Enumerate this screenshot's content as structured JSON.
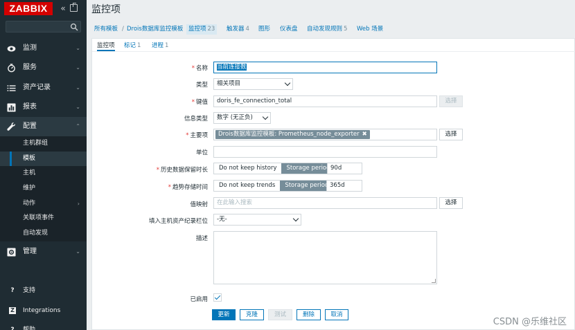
{
  "sidebar": {
    "logo": "ZABBIX",
    "search_placeholder": "",
    "menu": [
      {
        "label": "监测",
        "icon": "eye-icon"
      },
      {
        "label": "服务",
        "icon": "clock-icon"
      },
      {
        "label": "资产记录",
        "icon": "list-icon"
      },
      {
        "label": "报表",
        "icon": "chart-icon"
      },
      {
        "label": "配置",
        "icon": "wrench-icon"
      },
      {
        "label": "管理",
        "icon": "cog-icon"
      }
    ],
    "config_sub": [
      "主机群组",
      "模板",
      "主机",
      "维护",
      "动作",
      "关联项事件",
      "自动发现"
    ],
    "bottom": [
      {
        "label": "支持",
        "icon": "support-icon"
      },
      {
        "label": "Integrations",
        "icon": "integrations-icon"
      },
      {
        "label": "帮助",
        "icon": "help-icon"
      }
    ]
  },
  "main": {
    "title": "监控项",
    "breadcrumb": {
      "all_templates": "所有模板",
      "sep": "/",
      "template": "Drois数据库监控模板"
    },
    "tabs": [
      {
        "label": "监控项",
        "count": "23"
      },
      {
        "label": "触发器",
        "count": "4"
      },
      {
        "label": "图形",
        "count": ""
      },
      {
        "label": "仪表盘",
        "count": ""
      },
      {
        "label": "自动发现规则",
        "count": "5"
      },
      {
        "label": "Web 场景",
        "count": ""
      }
    ],
    "subtabs": [
      {
        "label": "监控项",
        "count": ""
      },
      {
        "label": "标记",
        "count": "1"
      },
      {
        "label": "进程",
        "count": "1"
      }
    ]
  },
  "form": {
    "name_label": "名称",
    "name_value": "当前连接数",
    "type_label": "类型",
    "type_value": "相关项目",
    "key_label": "键值",
    "key_value": "doris_fe_connection_total",
    "key_select": "选择",
    "info_type_label": "信息类型",
    "info_type_value": "数字 (无正负)",
    "master_label": "主要项",
    "master_value": "Drois数据库监控模板: Prometheus_node_exporter",
    "master_select": "选择",
    "units_label": "单位",
    "units_value": "",
    "history_label": "历史数据保留时长",
    "history_opt1": "Do not keep history",
    "history_opt2": "Storage period",
    "history_value": "90d",
    "trends_label": "趋势存储时间",
    "trends_opt1": "Do not keep trends",
    "trends_opt2": "Storage period",
    "trends_value": "365d",
    "valuemap_label": "值映射",
    "valuemap_placeholder": "在此输入搜索",
    "valuemap_select": "选择",
    "inventory_label": "填入主机资产纪录栏位",
    "inventory_value": "-无-",
    "desc_label": "描述",
    "enabled_label": "已启用",
    "buttons": {
      "update": "更新",
      "clone": "克隆",
      "test": "测试",
      "delete": "删除",
      "cancel": "取消"
    }
  },
  "watermark": "CSDN @乐维社区"
}
